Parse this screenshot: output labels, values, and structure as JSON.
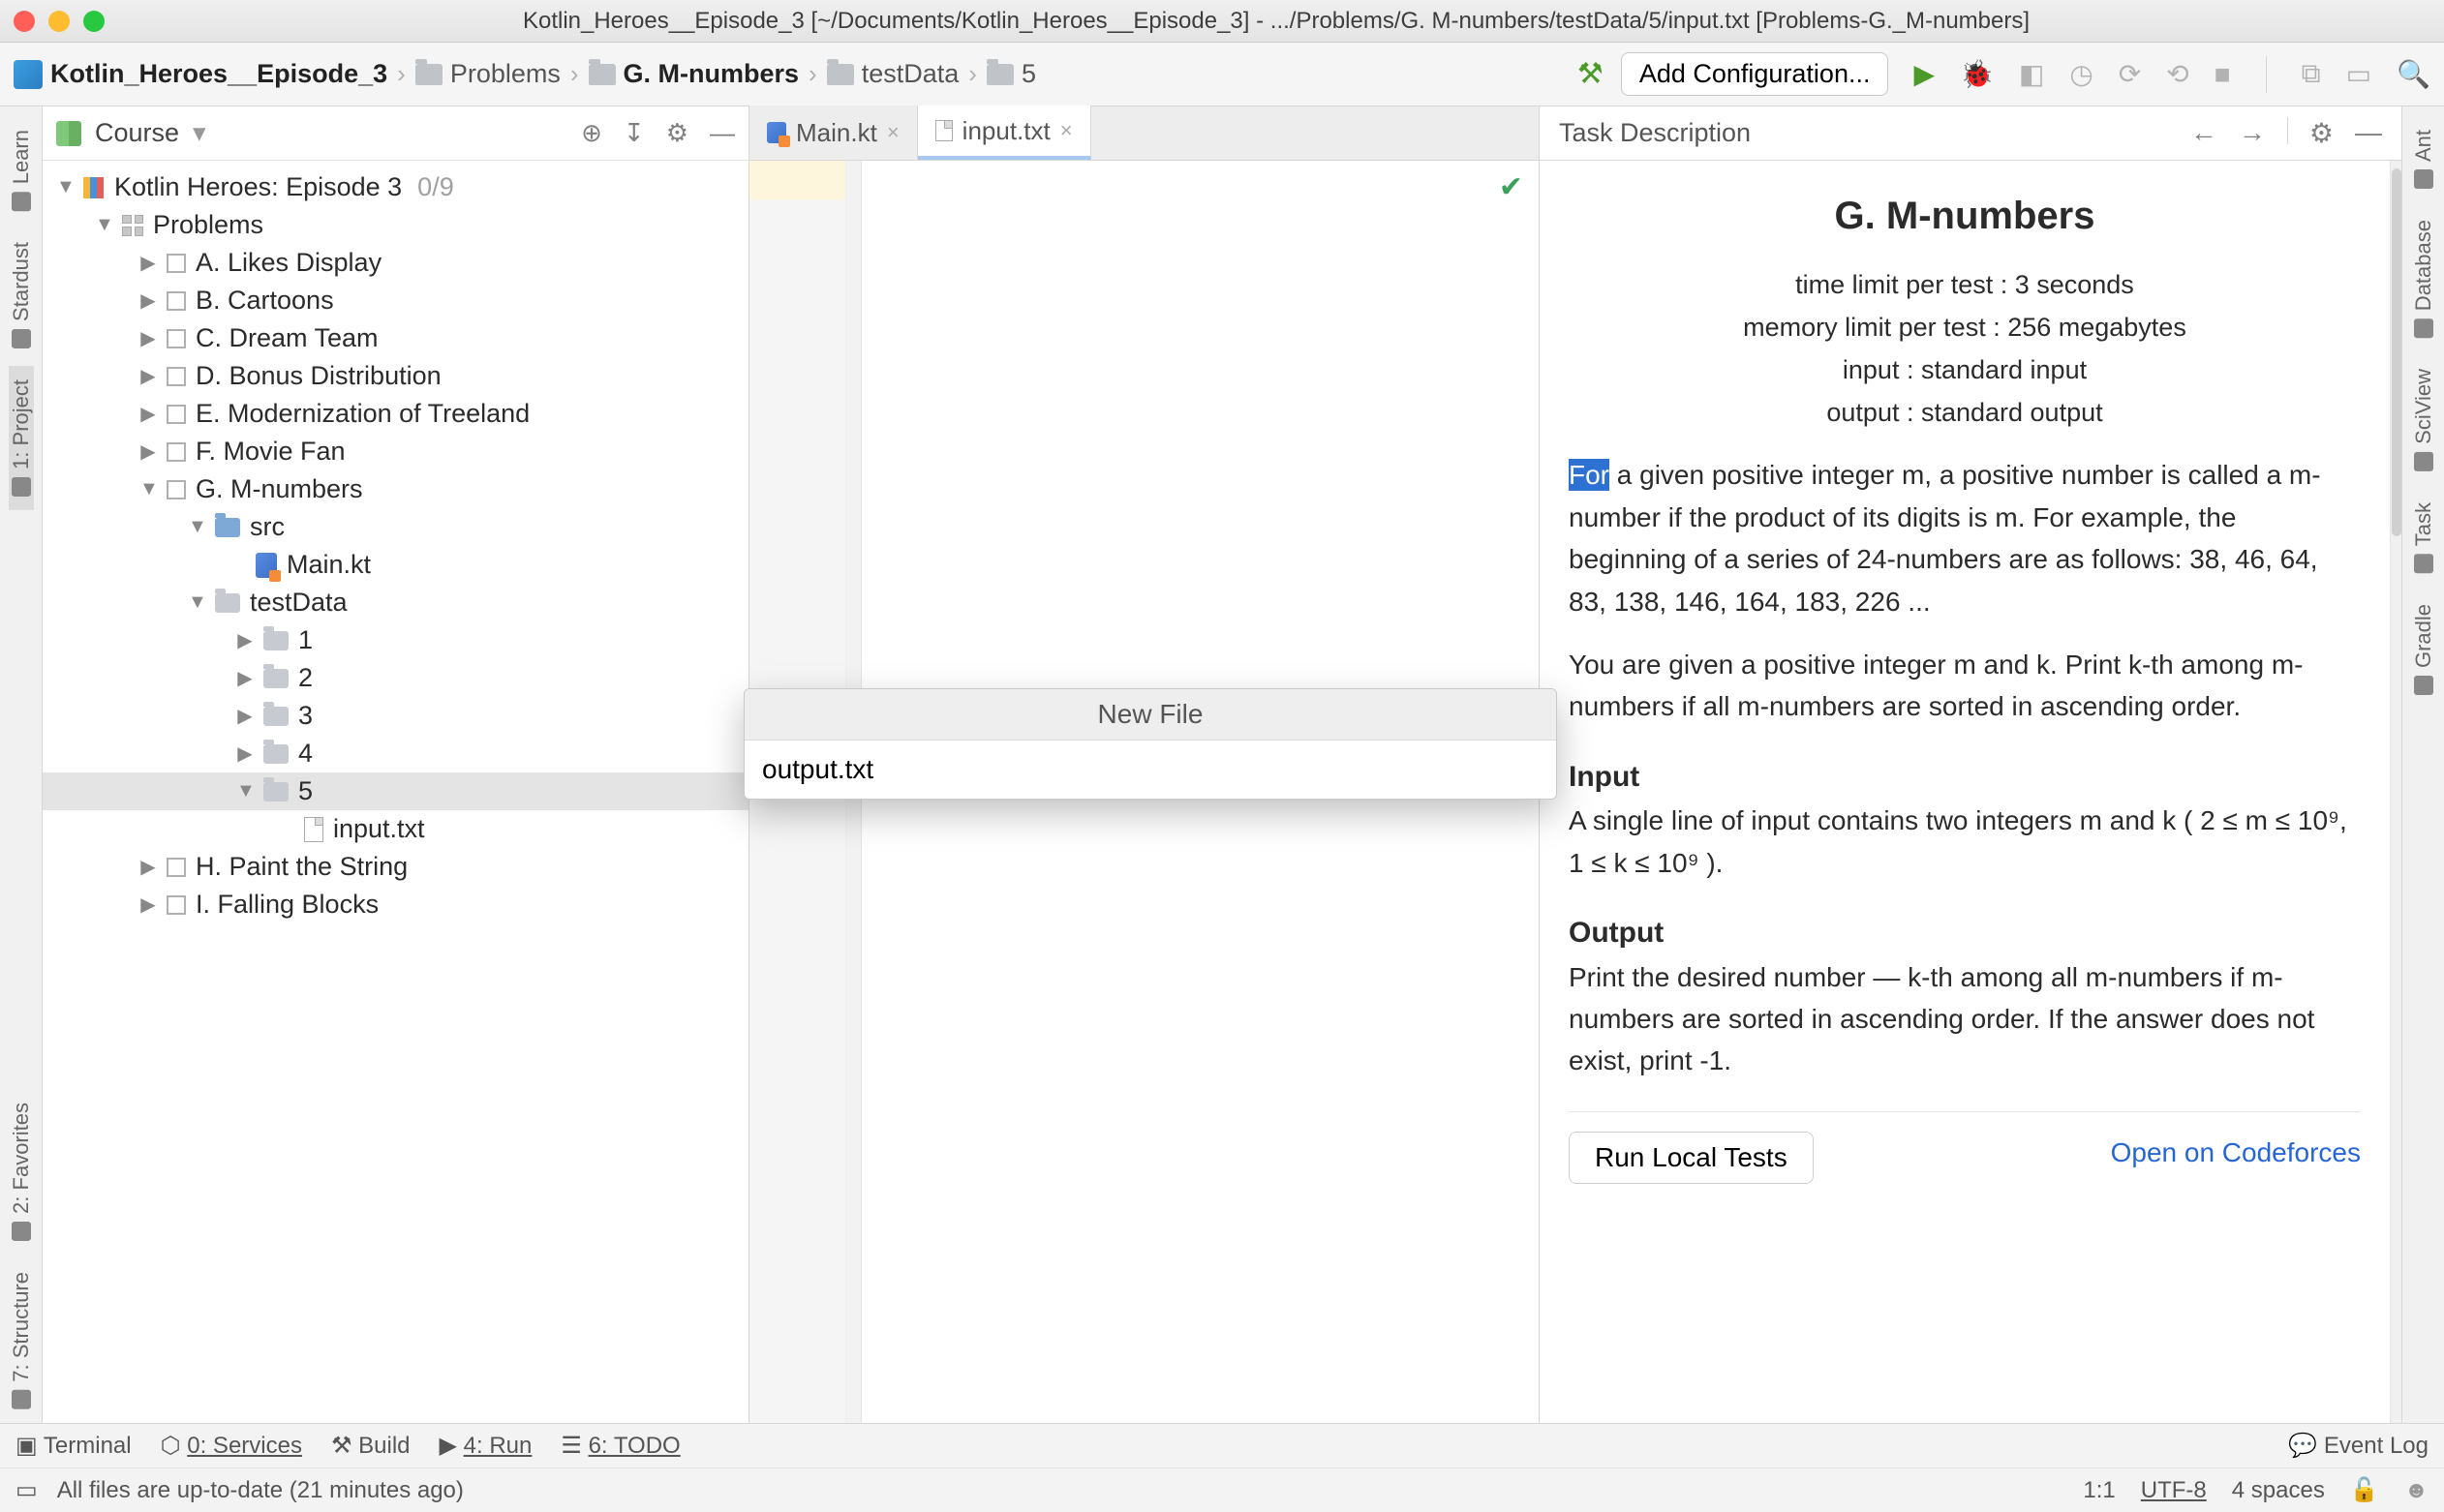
{
  "title": "Kotlin_Heroes__Episode_3 [~/Documents/Kotlin_Heroes__Episode_3] - .../Problems/G. M-numbers/testData/5/input.txt [Problems-G._M-numbers]",
  "breadcrumbs": {
    "root": "Kotlin_Heroes__Episode_3",
    "items": [
      "Problems",
      "G. M-numbers",
      "testData",
      "5"
    ]
  },
  "toolbar": {
    "add_config": "Add Configuration..."
  },
  "left_rail": {
    "learn": "Learn",
    "stardust": "Stardust",
    "project": "1: Project"
  },
  "right_rail": {
    "ant": "Ant",
    "database": "Database",
    "sciview": "SciView",
    "task": "Task",
    "gradle": "Gradle"
  },
  "side_panel": {
    "title": "Course",
    "course_title": "Kotlin Heroes: Episode 3",
    "counter": "0/9",
    "problems_label": "Problems",
    "problems": [
      "A. Likes Display",
      "B. Cartoons",
      "C. Dream Team",
      "D. Bonus Distribution",
      "E. Modernization of Treeland",
      "F. Movie Fan",
      "G. M-numbers",
      "H. Paint the String",
      "I. Falling Blocks"
    ],
    "src_label": "src",
    "main_kt": "Main.kt",
    "testdata_label": "testData",
    "folders": [
      "1",
      "2",
      "3",
      "4",
      "5"
    ],
    "input_file": "input.txt"
  },
  "tabs": [
    {
      "label": "Main.kt",
      "active": false
    },
    {
      "label": "input.txt",
      "active": true
    }
  ],
  "popup": {
    "title": "New File",
    "value": "output.txt"
  },
  "task": {
    "header": "Task Description",
    "title": "G. M-numbers",
    "meta": {
      "time": "time limit per test : 3 seconds",
      "memory": "memory limit per test : 256 megabytes",
      "input": "input : standard input",
      "output": "output : standard output"
    },
    "p1_prefix": "For",
    "p1_rest": " a given positive integer m, a positive number is called a m-number if the product of its digits is m. For example, the beginning of a series of 24-numbers are as follows: 38, 46, 64, 83, 138, 146, 164, 183, 226 ...",
    "p2": "You are given a positive integer m and k. Print k-th among m-numbers if all m-numbers are sorted in ascending order.",
    "input_h": "Input",
    "input_text": "A single line of input contains two integers m and k ( 2 ≤ m ≤ 10⁹, 1 ≤ k ≤ 10⁹ ).",
    "output_h": "Output",
    "output_text": "Print the desired number — k-th among all m-numbers if m-numbers are sorted in ascending order. If the answer does not exist, print -1.",
    "run": "Run Local Tests",
    "open": "Open on Codeforces"
  },
  "bottom": {
    "terminal": "Terminal",
    "services": "0: Services",
    "build": "Build",
    "run": "4: Run",
    "todo": "6: TODO",
    "eventlog": "Event Log"
  },
  "status": {
    "msg": "All files are up-to-date (21 minutes ago)",
    "pos": "1:1",
    "enc": "UTF-8",
    "indent": "4 spaces"
  }
}
